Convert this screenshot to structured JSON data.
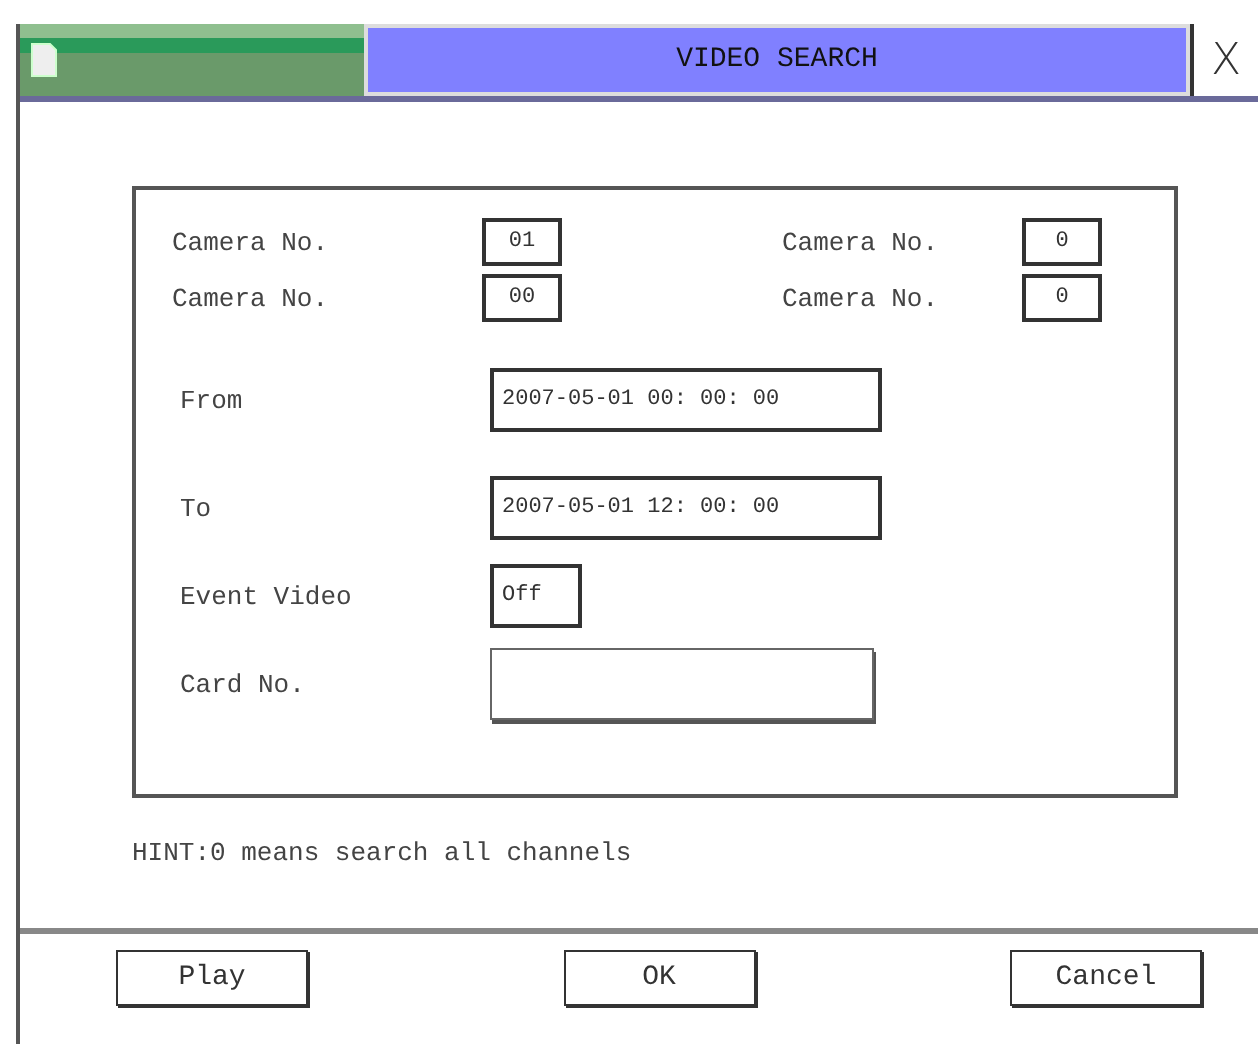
{
  "window": {
    "title": "VIDEO SEARCH",
    "close": "X"
  },
  "cameras": [
    {
      "label": "Camera No.",
      "value": "01"
    },
    {
      "label": "Camera No.",
      "value": "0"
    },
    {
      "label": "Camera No.",
      "value": "00"
    },
    {
      "label": "Camera No.",
      "value": "0"
    }
  ],
  "fields": [
    {
      "kind": "wide",
      "label": "From",
      "value": "2007-05-01 00: 00: 00"
    },
    {
      "kind": "wide",
      "label": "To",
      "value": "2007-05-01 12: 00: 00"
    },
    {
      "kind": "small",
      "label": "Event Video",
      "value": "Off"
    },
    {
      "kind": "input",
      "label": "Card No."
    }
  ],
  "hint": "HINT:0 means search all channels",
  "buttons": [
    "Play",
    "OK",
    "Cancel"
  ]
}
